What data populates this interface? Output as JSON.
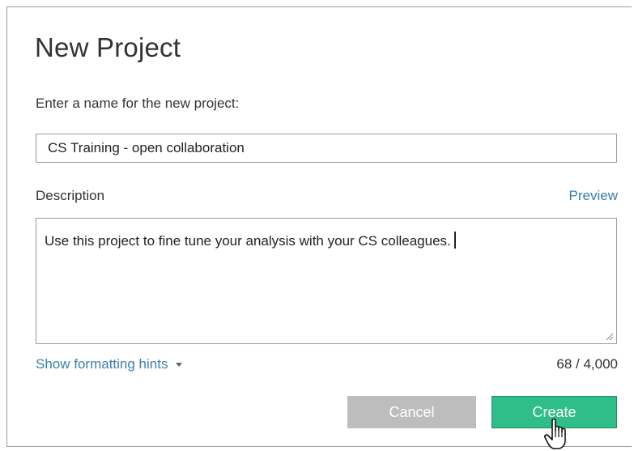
{
  "dialog": {
    "title": "New Project",
    "name_label": "Enter a name for the new project:",
    "name_value": "CS Training - open collaboration",
    "description_label": "Description",
    "preview_link": "Preview",
    "description_value": "Use this project to fine tune your analysis with your CS colleagues.",
    "formatting_hints_label": "Show formatting hints",
    "char_counter": "68 / 4,000",
    "cancel_label": "Cancel",
    "create_label": "Create"
  },
  "colors": {
    "link": "#3b7fad",
    "create_button": "#2fbd8a",
    "cancel_button": "#bdbdbd"
  },
  "icons": {
    "dropdown": "caret-down-icon",
    "resize": "resize-grip-icon",
    "pointer": "hand-pointer-icon"
  }
}
